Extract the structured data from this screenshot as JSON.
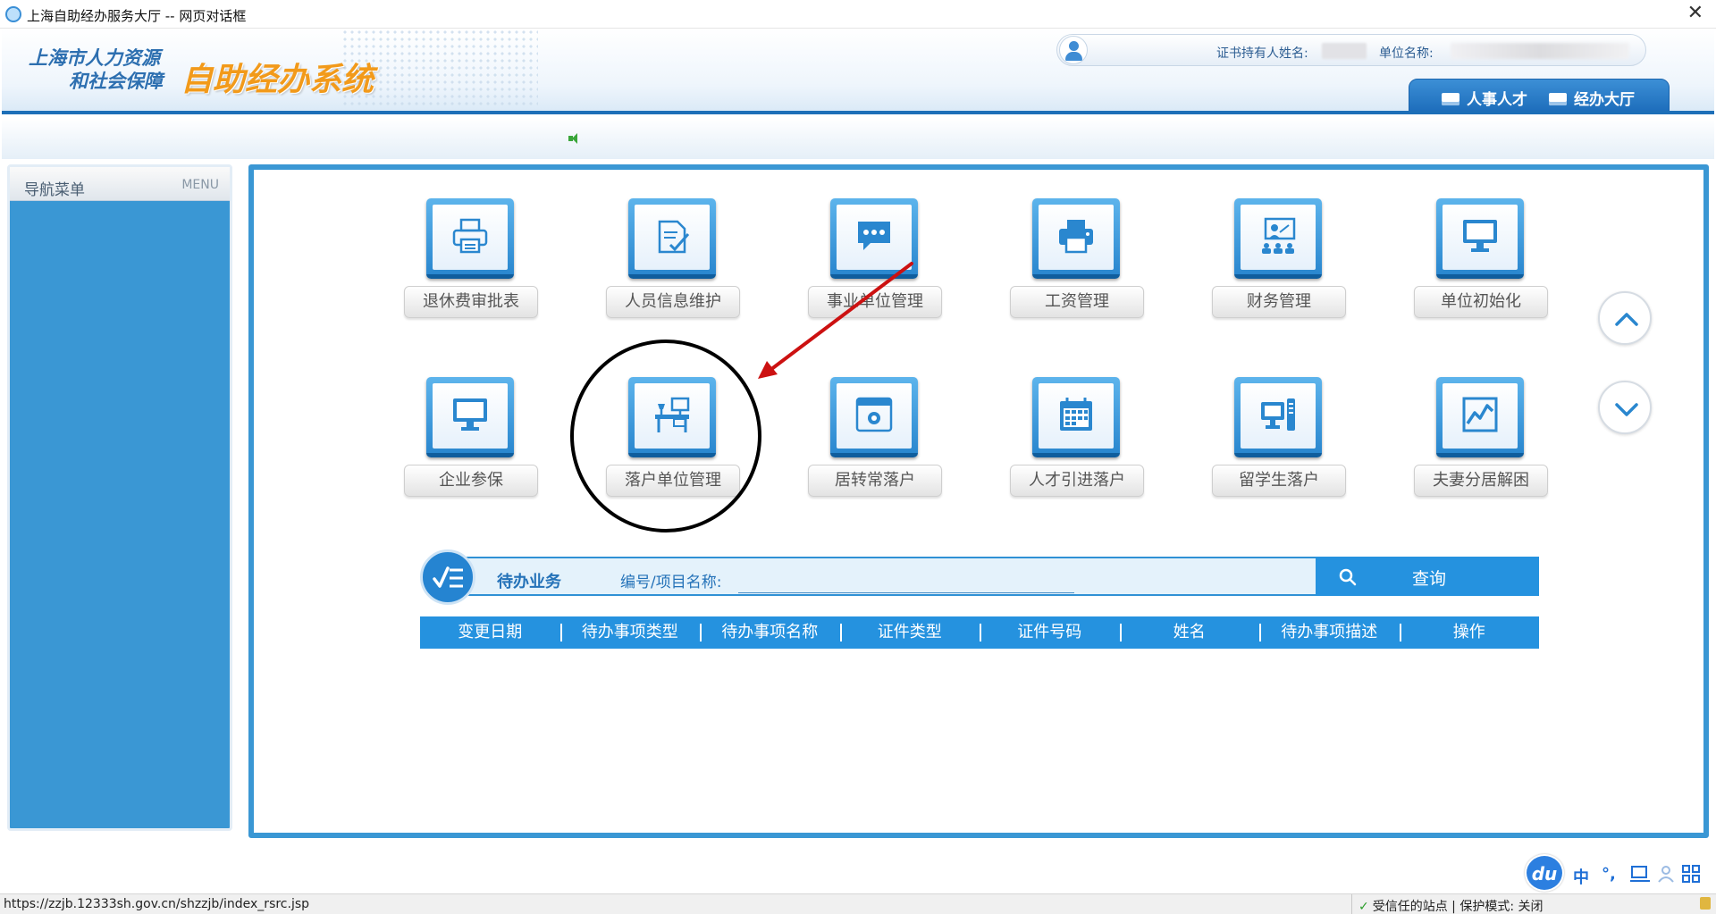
{
  "window": {
    "title": "上海自助经办服务大厅 -- 网页对话框",
    "close_glyph": "✕"
  },
  "header": {
    "logo_line1": "上海市人力资源",
    "logo_line2": "和社会保障",
    "system_name": "自助经办系统",
    "holder_label": "证书持有人姓名:",
    "unit_label": "单位名称:",
    "tabs": [
      {
        "label": "人事人才",
        "icon": "personnel-icon"
      },
      {
        "label": "经办大厅",
        "icon": "hall-icon"
      }
    ]
  },
  "sidebar": {
    "title": "导航菜单",
    "menu_tag": "MENU"
  },
  "tiles": [
    {
      "label": "退休费审批表",
      "icon": "printer-icon"
    },
    {
      "label": "人员信息维护",
      "icon": "document-check-icon"
    },
    {
      "label": "事业单位管理",
      "icon": "chat-bubble-icon"
    },
    {
      "label": "工资管理",
      "icon": "printer-icon"
    },
    {
      "label": "财务管理",
      "icon": "presentation-icon"
    },
    {
      "label": "单位初始化",
      "icon": "monitor-icon"
    },
    {
      "label": "企业参保",
      "icon": "monitor-icon"
    },
    {
      "label": "落户单位管理",
      "icon": "desk-icon"
    },
    {
      "label": "居转常落户",
      "icon": "browser-gear-icon"
    },
    {
      "label": "人才引进落户",
      "icon": "calendar-icon"
    },
    {
      "label": "留学生落户",
      "icon": "computer-tower-icon"
    },
    {
      "label": "夫妻分居解困",
      "icon": "line-chart-icon"
    }
  ],
  "pending": {
    "title": "待办业务",
    "query_label": "编号/项目名称:",
    "query_value": "",
    "query_placeholder": "",
    "search_label": "查询"
  },
  "table": {
    "columns": [
      "变更日期",
      "待办事项类型",
      "待办事项名称",
      "证件类型",
      "证件号码",
      "姓名",
      "待办事项描述",
      "操作"
    ]
  },
  "tray": {
    "baidu_label": "du",
    "ime_label": "中",
    "punct_label": "°,"
  },
  "status": {
    "url": "https://zzjb.12333sh.gov.cn/shzzjb/index_rsrc.jsp",
    "trust_text": "受信任的站点 | 保护模式: 关闭"
  },
  "colors": {
    "accent": "#2592df",
    "logo_orange": "#f29a1a",
    "annotation_arrow": "#cc1111"
  }
}
